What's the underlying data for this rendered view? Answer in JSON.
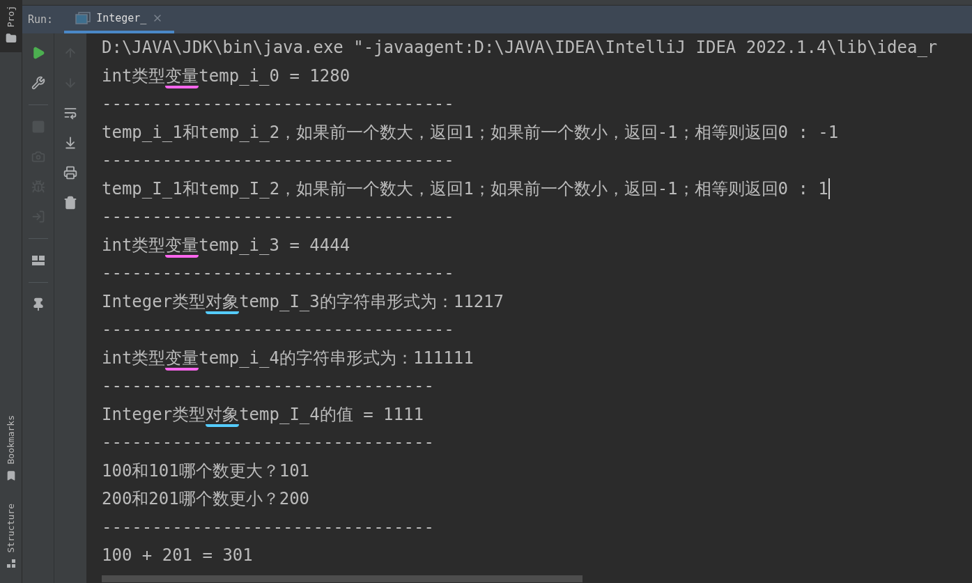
{
  "left_stripe": {
    "top": [
      {
        "label": "Proj",
        "kind": "folder"
      }
    ],
    "bottom": [
      {
        "label": "Bookmarks",
        "kind": "bookmark"
      },
      {
        "label": "Structure",
        "kind": "structure"
      }
    ]
  },
  "run_panel": {
    "label": "Run:",
    "tabs": [
      {
        "label": "Integer_",
        "selected": true
      }
    ]
  },
  "toolbar_left": [
    {
      "kind": "run",
      "disabled": false
    },
    {
      "kind": "wrench",
      "disabled": false
    },
    {
      "kind": "separator"
    },
    {
      "kind": "stop",
      "disabled": true
    },
    {
      "kind": "camera",
      "disabled": true
    },
    {
      "kind": "bug",
      "disabled": true
    },
    {
      "kind": "exit",
      "disabled": true
    },
    {
      "kind": "separator"
    },
    {
      "kind": "layout",
      "disabled": false
    },
    {
      "kind": "separator"
    },
    {
      "kind": "pin",
      "disabled": false
    }
  ],
  "toolbar_right": [
    {
      "kind": "up",
      "disabled": true
    },
    {
      "kind": "down",
      "disabled": true
    },
    {
      "kind": "wrap",
      "disabled": false
    },
    {
      "kind": "scroll_end",
      "disabled": false
    },
    {
      "kind": "print",
      "disabled": false
    },
    {
      "kind": "trash",
      "disabled": false
    }
  ],
  "console": {
    "lines": [
      {
        "caret": false,
        "segments": [
          {
            "text": "D:\\JAVA\\JDK\\bin\\java.exe \"-javaagent:D:\\JAVA\\IDEA\\IntelliJ IDEA 2022.1.4\\lib\\idea_r"
          }
        ]
      },
      {
        "caret": false,
        "segments": [
          {
            "text": "int类型"
          },
          {
            "text": "变量",
            "color": "#ff66ee"
          },
          {
            "text": "temp_i_0 = 1280"
          }
        ]
      },
      {
        "caret": false,
        "segments": [
          {
            "text": "-----------------------------------"
          }
        ]
      },
      {
        "caret": false,
        "segments": [
          {
            "text": "temp_i_1和temp_i_2，如果前一个数大，返回1；如果前一个数小，返回-1；相等则返回0 : -1"
          }
        ]
      },
      {
        "caret": false,
        "segments": [
          {
            "text": "-----------------------------------"
          }
        ]
      },
      {
        "caret": true,
        "segments": [
          {
            "text": "temp_I_1和temp_I_2，如果前一个数大，返回1；如果前一个数小，返回-1；相等则返回0 : 1"
          }
        ]
      },
      {
        "caret": false,
        "segments": [
          {
            "text": "-----------------------------------"
          }
        ]
      },
      {
        "caret": false,
        "segments": [
          {
            "text": "int类型"
          },
          {
            "text": "变量",
            "color": "#ff66ee"
          },
          {
            "text": "temp_i_3 = 4444"
          }
        ]
      },
      {
        "caret": false,
        "segments": [
          {
            "text": "-----------------------------------"
          }
        ]
      },
      {
        "caret": false,
        "segments": [
          {
            "text": "Integer类型"
          },
          {
            "text": "对象",
            "color": "#55ccff"
          },
          {
            "text": "temp_I_3的字符串形式为：11217"
          }
        ]
      },
      {
        "caret": false,
        "segments": [
          {
            "text": "-----------------------------------"
          }
        ]
      },
      {
        "caret": false,
        "segments": [
          {
            "text": "int类型"
          },
          {
            "text": "变量",
            "color": "#ff66ee"
          },
          {
            "text": "temp_i_4的字符串形式为：111111"
          }
        ]
      },
      {
        "caret": false,
        "segments": [
          {
            "text": "---------------------------------"
          }
        ]
      },
      {
        "caret": false,
        "segments": [
          {
            "text": "Integer类型"
          },
          {
            "text": "对象",
            "color": "#55ccff"
          },
          {
            "text": "temp_I_4的值 = 1111"
          }
        ]
      },
      {
        "caret": false,
        "segments": [
          {
            "text": "---------------------------------"
          }
        ]
      },
      {
        "caret": false,
        "segments": [
          {
            "text": "100和101哪个数更大？101"
          }
        ]
      },
      {
        "caret": false,
        "segments": [
          {
            "text": "200和201哪个数更小？200"
          }
        ]
      },
      {
        "caret": false,
        "segments": [
          {
            "text": "---------------------------------"
          }
        ]
      },
      {
        "caret": false,
        "segments": [
          {
            "text": "100 + 201 = 301"
          }
        ]
      }
    ]
  }
}
